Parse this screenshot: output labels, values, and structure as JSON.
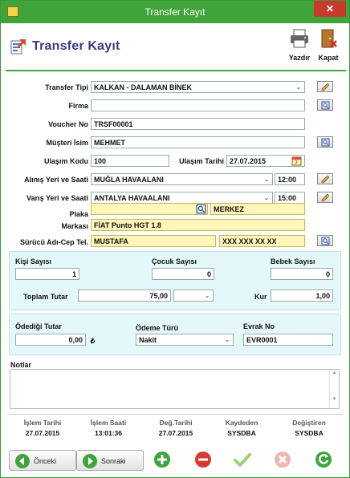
{
  "window": {
    "title": "Transfer Kayıt",
    "close_label": "✕"
  },
  "header": {
    "title": "Transfer Kayıt",
    "print_label": "Yazdır",
    "close_label": "Kapat"
  },
  "form": {
    "transfer_tipi": {
      "label": "Transfer Tipi",
      "value": "KALKAN - DALAMAN BİNEK"
    },
    "firma": {
      "label": "Firma",
      "value": ""
    },
    "voucher_no": {
      "label": "Voucher No",
      "value": "TRSF00001"
    },
    "musteri_isim": {
      "label": "Müşteri İsim",
      "value": "MEHMET"
    },
    "ulasim_kodu": {
      "label": "Ulaşım Kodu",
      "value": "100"
    },
    "ulasim_tarihi": {
      "label": "Ulaşım Tarihi",
      "value": "27.07.2015"
    },
    "alinis": {
      "label": "Alınış Yeri ve Saati",
      "value": "MUĞLA HAVAALANI",
      "time": "12:00"
    },
    "varis": {
      "label": "Varış Yeri ve Saati",
      "value": "ANTALYA HAVAALANI",
      "time": "15:00"
    },
    "plaka": {
      "label": "Plaka",
      "value": "",
      "extra": "MERKEZ"
    },
    "markasi": {
      "label": "Markası",
      "value": "FİAT  Punto HGT 1.8"
    },
    "surucu": {
      "label": "Sürücü Adı-Cep Tel.",
      "name": "MUSTAFA",
      "phone": "XXX XXX XX XX"
    }
  },
  "counts": {
    "kisi": {
      "label": "Kişi Sayısı",
      "value": "1"
    },
    "cocuk": {
      "label": "Çocuk Sayısı",
      "value": "0"
    },
    "bebek": {
      "label": "Bebek Sayısı",
      "value": "0"
    },
    "toplam": {
      "label": "Toplam Tutar",
      "value": "75,00"
    },
    "kur": {
      "label": "Kur",
      "value": "1,00"
    }
  },
  "payment": {
    "odedigi": {
      "label": "Ödediği Tutar",
      "value": "0,00",
      "currency": "₺"
    },
    "odeme_turu": {
      "label": "Ödeme Türü",
      "value": "Nakit"
    },
    "evrak": {
      "label": "Evrak No",
      "value": "EVR0001"
    }
  },
  "notes": {
    "label": "Notlar",
    "value": ""
  },
  "footer": {
    "islem_tarihi": {
      "label": "İşlem Tarihi",
      "value": "27.07.2015"
    },
    "islem_saati": {
      "label": "İşlem Saati",
      "value": "13:01:36"
    },
    "deg_tarihi": {
      "label": "Değ.Tarihi",
      "value": "27.07.2015"
    },
    "kaydeden": {
      "label": "Kaydeden",
      "value": "SYSDBA"
    },
    "degistiren": {
      "label": "Değiştiren",
      "value": "SYSDBA"
    }
  },
  "nav": {
    "prev_label": "Önceki",
    "next_label": "Sonraki"
  },
  "colors": {
    "title_bar": "#3fa43a",
    "panel": "#e4f7fb",
    "highlight": "#fff6b8",
    "close": "#c83a2c"
  }
}
